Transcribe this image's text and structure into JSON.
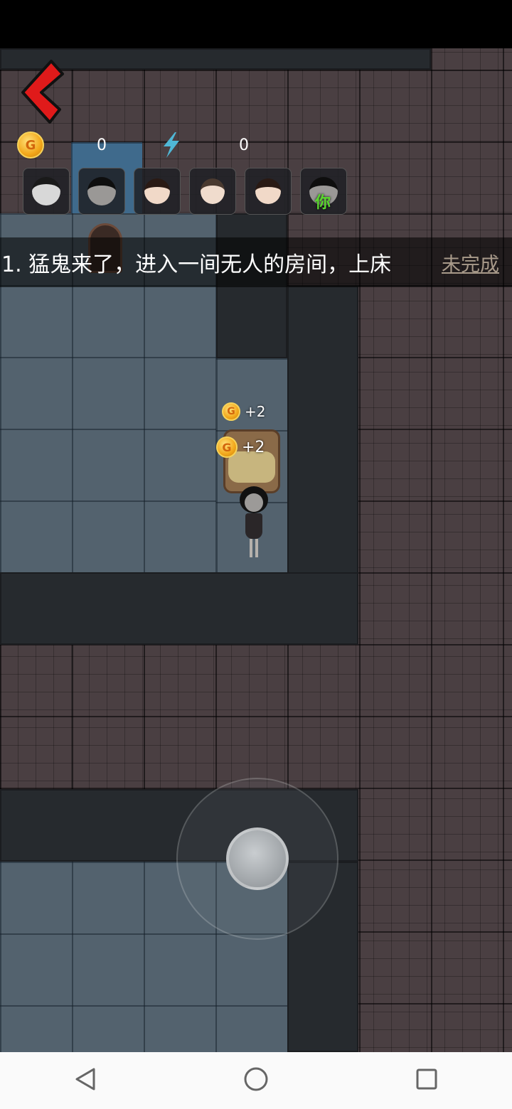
{
  "hud": {
    "coins": "0",
    "energy": "0",
    "coin_letter": "G"
  },
  "players": [
    {
      "name": "ghost-player",
      "label": ""
    },
    {
      "name": "player-2",
      "label": ""
    },
    {
      "name": "player-3",
      "label": ""
    },
    {
      "name": "player-4",
      "label": ""
    },
    {
      "name": "player-5",
      "label": ""
    },
    {
      "name": "player-you",
      "label": "你"
    }
  ],
  "mission": {
    "text": "1. 猛鬼来了，进入一间无人的房间，上床",
    "status": "未完成"
  },
  "floating_rewards": [
    "+2",
    "+2"
  ],
  "colors": {
    "back_arrow": "#e01a1a",
    "coin": "#f2a71a",
    "energy": "#4fb7d6",
    "you_label": "#5ad82e"
  }
}
